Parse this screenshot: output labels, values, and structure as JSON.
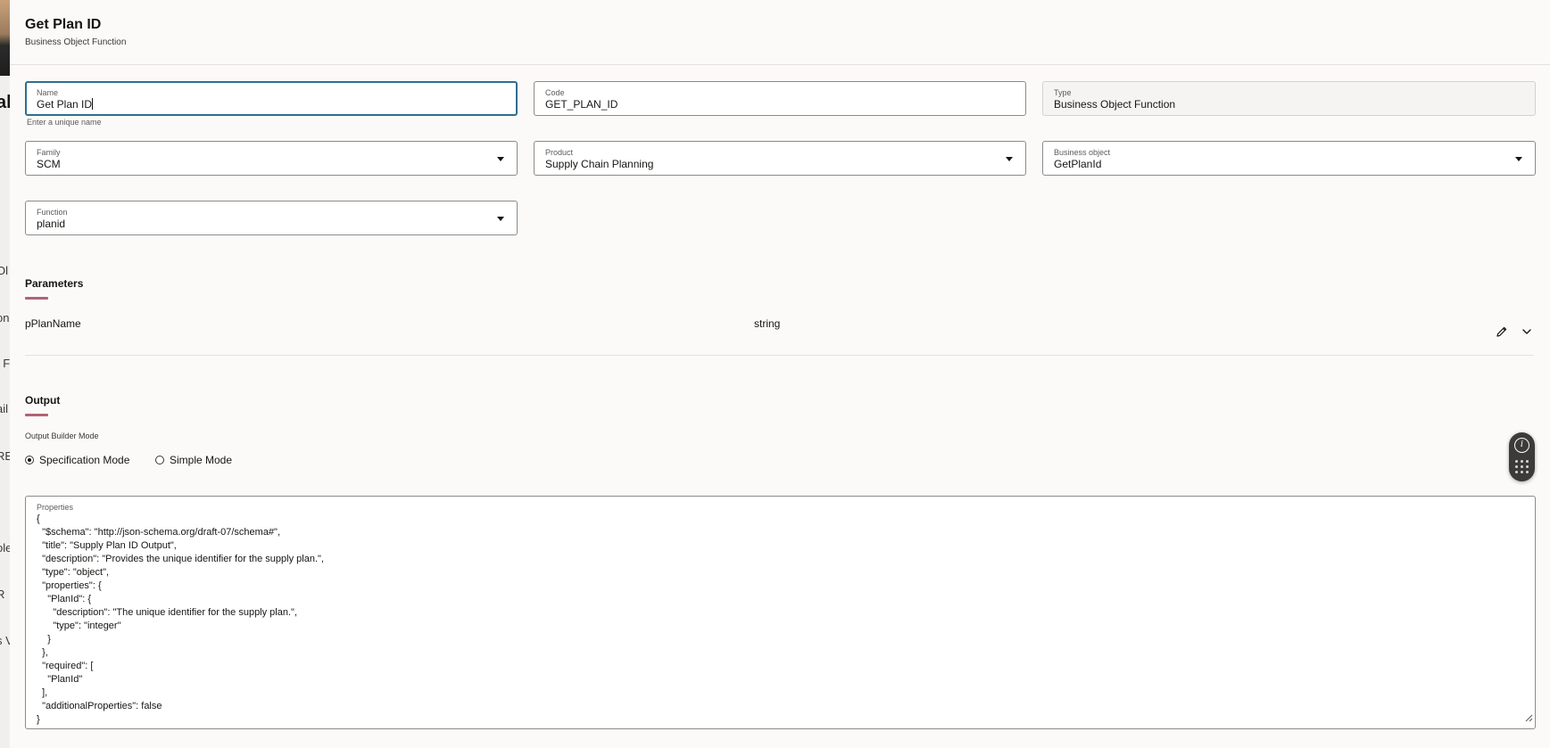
{
  "header": {
    "title": "Get Plan ID",
    "subtitle": "Business Object Function"
  },
  "form": {
    "name": {
      "label": "Name",
      "value": "Get Plan ID",
      "helper": "Enter a unique name"
    },
    "code": {
      "label": "Code",
      "value": "GET_PLAN_ID"
    },
    "type": {
      "label": "Type",
      "value": "Business Object Function"
    },
    "family": {
      "label": "Family",
      "value": "SCM"
    },
    "product": {
      "label": "Product",
      "value": "Supply Chain Planning"
    },
    "business_object": {
      "label": "Business object",
      "value": "GetPlanId"
    },
    "function": {
      "label": "Function",
      "value": "planid"
    }
  },
  "parameters": {
    "title": "Parameters",
    "items": [
      {
        "name": "pPlanName",
        "type": "string",
        "edit_icon": "pencil-icon",
        "expand_icon": "chevron-down-icon"
      }
    ]
  },
  "output": {
    "title": "Output",
    "mode_label": "Output Builder Mode",
    "modes": [
      {
        "label": "Specification Mode",
        "selected": true
      },
      {
        "label": "Simple Mode",
        "selected": false
      }
    ],
    "properties_label": "Properties",
    "properties_value": "{\n  \"$schema\": \"http://json-schema.org/draft-07/schema#\",\n  \"title\": \"Supply Plan ID Output\",\n  \"description\": \"Provides the unique identifier for the supply plan.\",\n  \"type\": \"object\",\n  \"properties\": {\n    \"PlanId\": {\n      \"description\": \"The unique identifier for the supply plan.\",\n      \"type\": \"integer\"\n    }\n  },\n  \"required\": [\n    \"PlanId\"\n  ],\n  \"additionalProperties\": false\n}"
  },
  "background_fragments": [
    "al",
    "Ol",
    "on",
    "t F",
    "ail",
    "RE",
    "ole",
    "R",
    "s V"
  ],
  "colors": {
    "accent_underline": "#b06374",
    "focus_border": "#2e6f8e",
    "page_bg": "#fbfaf9"
  }
}
